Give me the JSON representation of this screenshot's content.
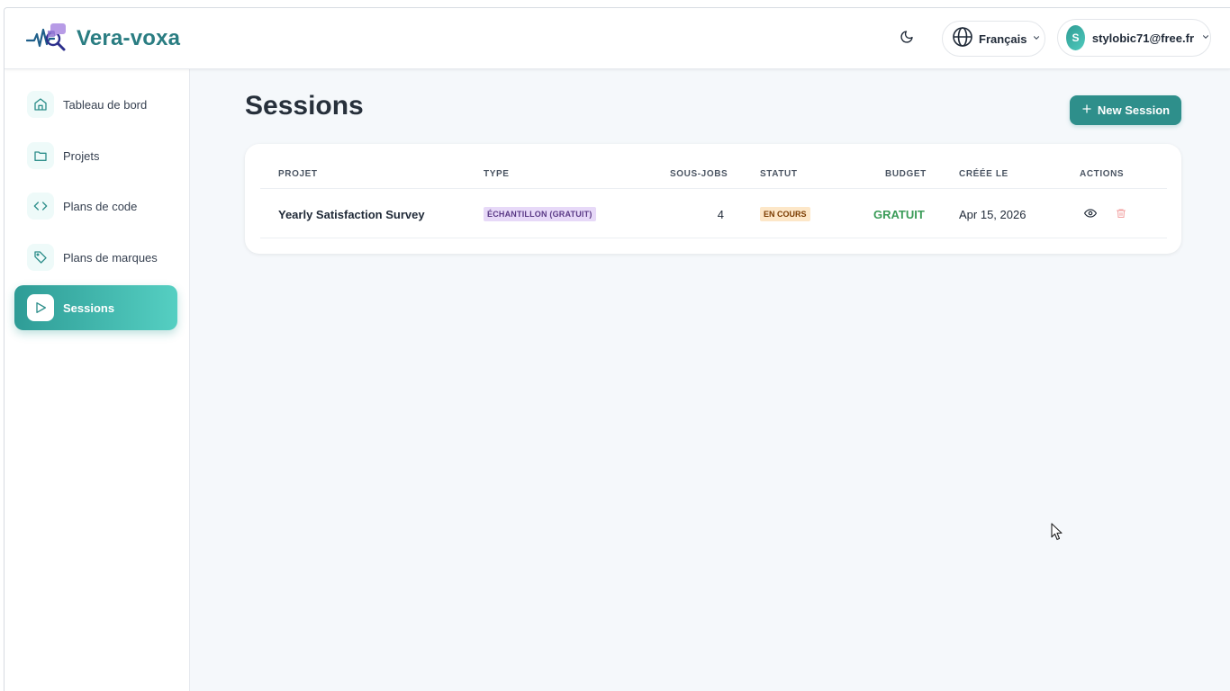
{
  "app": {
    "name": "Vera-voxa"
  },
  "header": {
    "language": "Français",
    "user_initial": "S",
    "user_email": "stylobic71@free.fr"
  },
  "sidebar": {
    "items": [
      {
        "label": "Tableau de bord",
        "icon": "home-icon",
        "active": false
      },
      {
        "label": "Projets",
        "icon": "folder-icon",
        "active": false
      },
      {
        "label": "Plans de code",
        "icon": "code-icon",
        "active": false
      },
      {
        "label": "Plans de marques",
        "icon": "tag-icon",
        "active": false
      },
      {
        "label": "Sessions",
        "icon": "play-icon",
        "active": true
      }
    ]
  },
  "main": {
    "title": "Sessions",
    "new_button": "New Session",
    "table": {
      "columns": [
        "PROJET",
        "TYPE",
        "SOUS-JOBS",
        "STATUT",
        "BUDGET",
        "CRÉÉE LE",
        "ACTIONS"
      ],
      "rows": [
        {
          "project": "Yearly Satisfaction Survey",
          "type": "ÉCHANTILLON (GRATUIT)",
          "subjobs": "4",
          "status": "EN COURS",
          "budget": "GRATUIT",
          "created": "Apr 15, 2026"
        }
      ]
    }
  },
  "colors": {
    "brand": "#2a7d82",
    "accent": "#2e8f8b",
    "budget_green": "#3a9b57",
    "type_badge_bg": "#e7d9f8",
    "status_badge_bg": "#fde7c8",
    "delete_red": "#f2a0a0"
  }
}
